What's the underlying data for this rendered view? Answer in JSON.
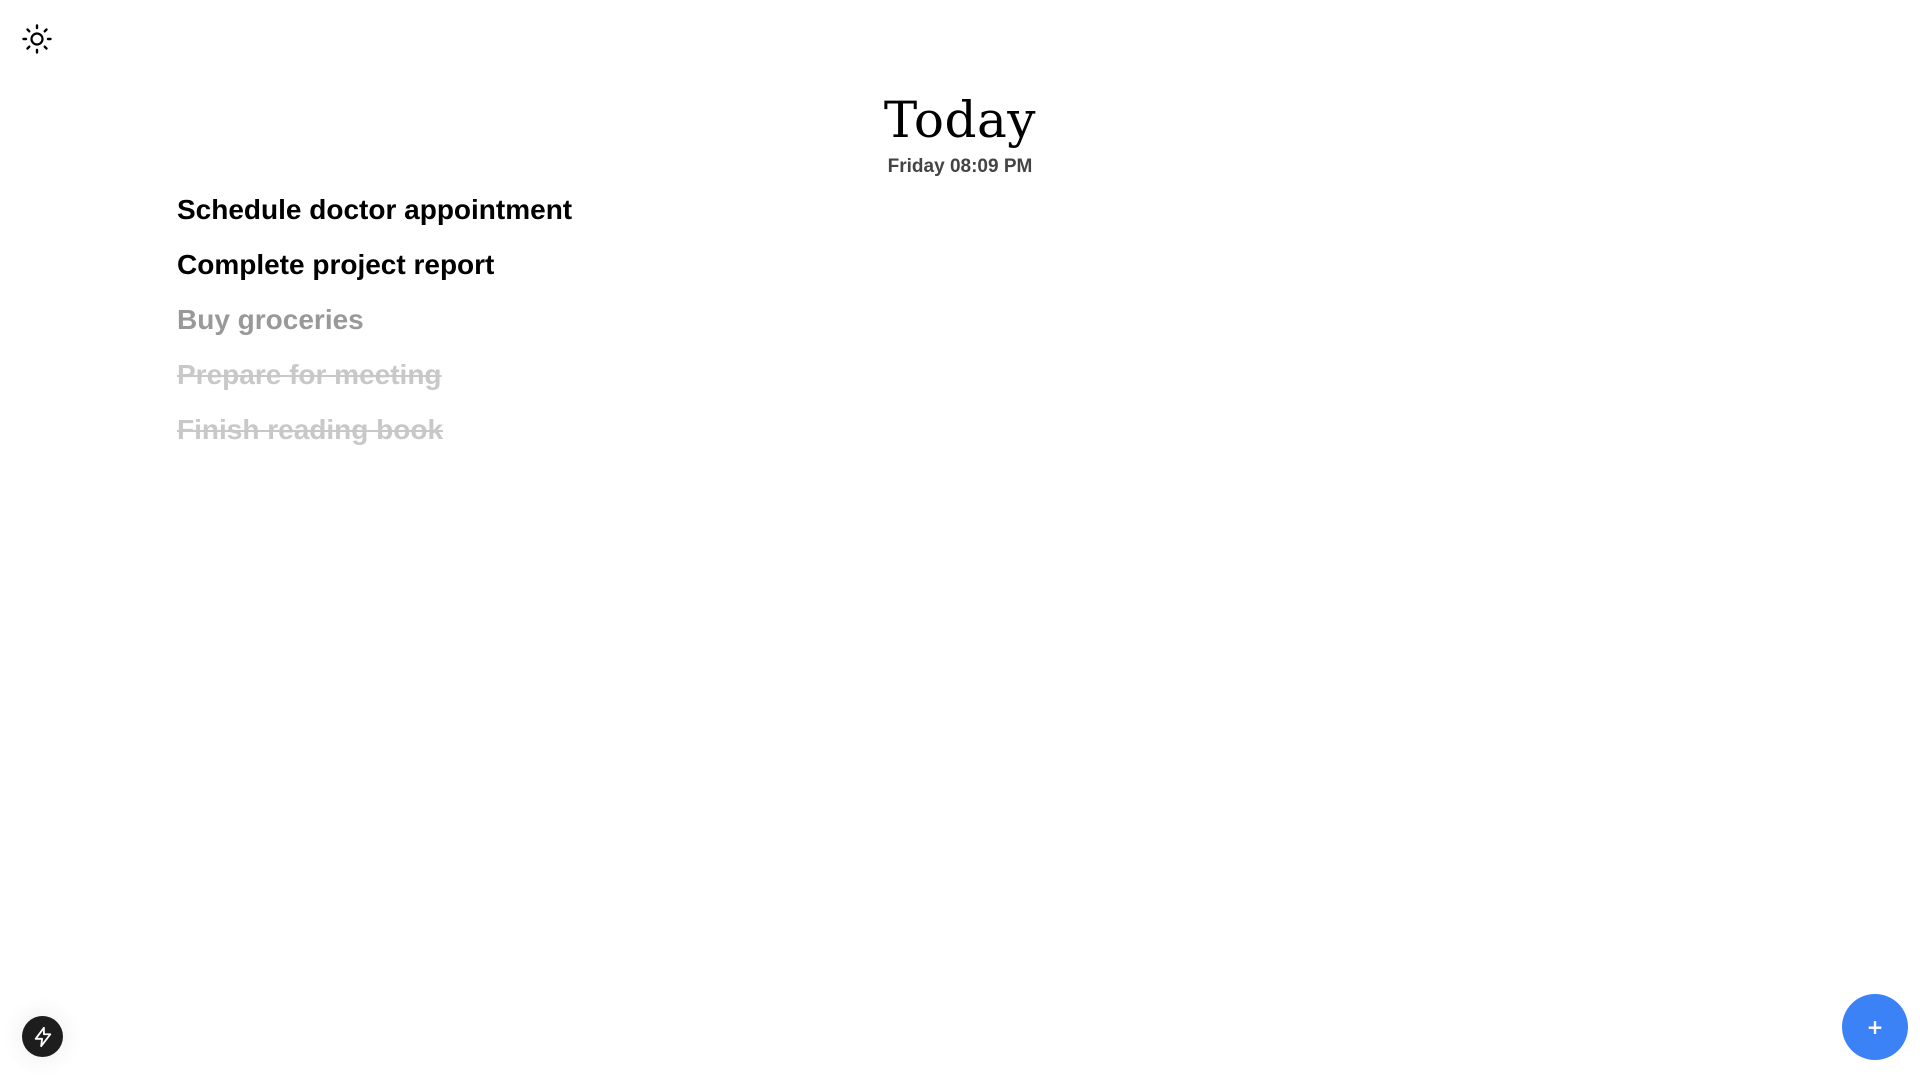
{
  "app": {
    "title": "Today",
    "datetime": "Friday 08:09 PM"
  },
  "toolbar": {
    "theme_icon": "sun-icon"
  },
  "tasks": [
    {
      "label": "Schedule doctor appointment",
      "state": "active"
    },
    {
      "label": "Complete project report",
      "state": "active"
    },
    {
      "label": "Buy groceries",
      "state": "dim"
    },
    {
      "label": "Prepare for meeting",
      "state": "done"
    },
    {
      "label": "Finish reading book",
      "state": "done"
    }
  ],
  "actions": {
    "add_label": "+",
    "add_color": "#3b82f6",
    "flash_icon": "lightning-icon"
  }
}
